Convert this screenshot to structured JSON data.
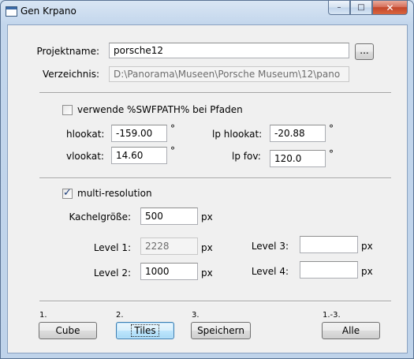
{
  "window": {
    "title": "Gen Krpano",
    "min_glyph": "–",
    "max_glyph": "□",
    "close_glyph": "✕"
  },
  "project": {
    "name_label": "Projektname:",
    "name_value": "porsche12",
    "browse_label": "...",
    "dir_label": "Verzeichnis:",
    "dir_value": "D:\\Panorama\\Museen\\Porsche Museum\\12\\pano"
  },
  "view": {
    "swfpath_label": "verwende %SWFPATH% bei Pfaden",
    "swfpath_checked": false,
    "hlookat_label": "hlookat:",
    "hlookat_value": "-159.00",
    "vlookat_label": "vlookat:",
    "vlookat_value": "14.60",
    "lp_hlookat_label": "lp hlookat:",
    "lp_hlookat_value": "-20.88",
    "lp_fov_label": "lp fov:",
    "lp_fov_value": "120.0",
    "degree_unit": "°"
  },
  "multires": {
    "checkbox_label": "multi-resolution",
    "checked": true,
    "check_glyph": "✓",
    "tile_size_label": "Kachelgröße:",
    "tile_size_value": "500",
    "px_unit": "px",
    "level1_label": "Level 1:",
    "level1_value": "2228",
    "level2_label": "Level 2:",
    "level2_value": "1000",
    "level3_label": "Level 3:",
    "level3_value": "",
    "level4_label": "Level 4:",
    "level4_value": ""
  },
  "actions": {
    "step_cube": "1.",
    "cube_label": "Cube",
    "step_tiles": "2.",
    "tiles_label": "Tiles",
    "step_save": "3.",
    "save_label": "Speichern",
    "step_all": "1.-3.",
    "all_label": "Alle"
  }
}
